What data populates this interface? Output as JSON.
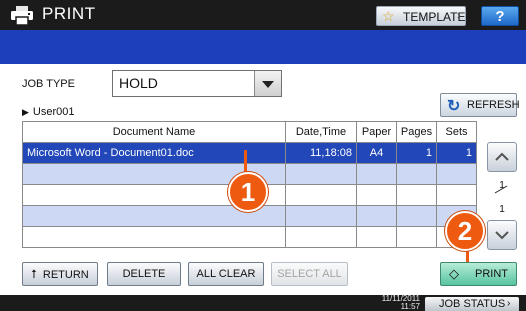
{
  "header": {
    "title": "PRINT",
    "template_label": "TEMPLATE",
    "help_label": "?"
  },
  "job_type": {
    "label": "JOB TYPE",
    "value": "HOLD"
  },
  "user": {
    "name": "User001"
  },
  "refresh_label": "REFRESH",
  "table": {
    "columns": [
      "Document Name",
      "Date,Time",
      "Paper",
      "Pages",
      "Sets"
    ],
    "rows": [
      {
        "document_name": "Microsoft Word - Document01.doc",
        "date_time": "11,18:08",
        "paper": "A4",
        "pages": "1",
        "sets": "1"
      },
      {
        "document_name": "",
        "date_time": "",
        "paper": "",
        "pages": "",
        "sets": ""
      },
      {
        "document_name": "",
        "date_time": "",
        "paper": "",
        "pages": "",
        "sets": ""
      },
      {
        "document_name": "",
        "date_time": "",
        "paper": "",
        "pages": "",
        "sets": ""
      },
      {
        "document_name": "",
        "date_time": "",
        "paper": "",
        "pages": "",
        "sets": ""
      }
    ]
  },
  "pagination": {
    "current": "1",
    "total": "1"
  },
  "callouts": {
    "one": "1",
    "two": "2"
  },
  "buttons": {
    "return": "RETURN",
    "delete": "DELETE",
    "all_clear": "ALL CLEAR",
    "select_all": "SELECT ALL",
    "print": "PRINT"
  },
  "status": {
    "date": "11/11/2011",
    "time": "11:57",
    "job_status": "JOB STATUS"
  },
  "colors": {
    "title_bar": "#1b1b1b",
    "blue_bar": "#1e3fbc",
    "selected_row": "#2147b8",
    "alt_row": "#ccd8f4",
    "callout": "#ee5a0f",
    "print_button": "#57c4a0"
  }
}
